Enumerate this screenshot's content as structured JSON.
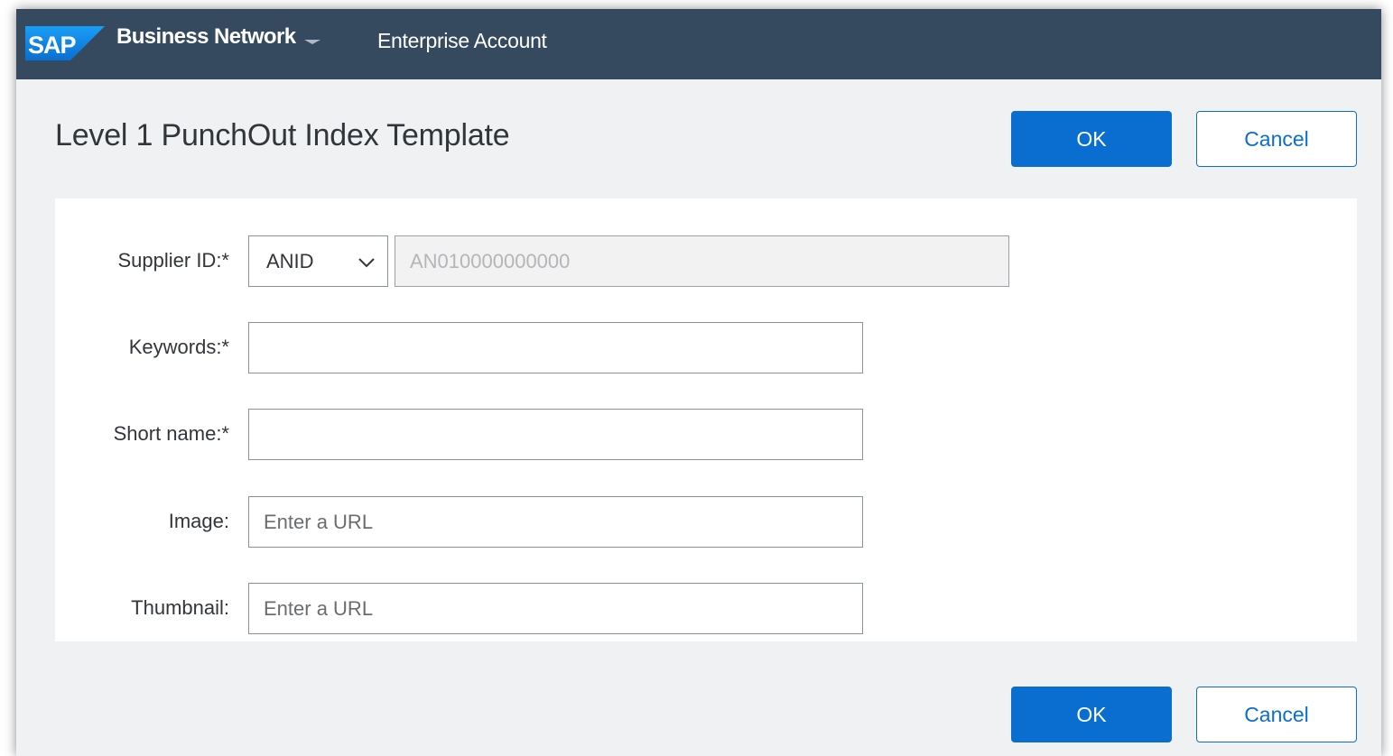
{
  "shellbar": {
    "logo_text": "SAP",
    "product_name": "Business Network",
    "account_type": "Enterprise Account"
  },
  "page": {
    "title": "Level 1 PunchOut Index Template"
  },
  "actions": {
    "ok_label": "OK",
    "cancel_label": "Cancel"
  },
  "form": {
    "supplier_id": {
      "label": "Supplier ID:*",
      "type_value": "ANID",
      "id_value": "AN010000000000"
    },
    "keywords": {
      "label": "Keywords:*",
      "value": "",
      "placeholder": ""
    },
    "short_name": {
      "label": "Short name:*",
      "value": "",
      "placeholder": ""
    },
    "image": {
      "label": "Image:",
      "value": "",
      "placeholder": "Enter a URL"
    },
    "thumbnail": {
      "label": "Thumbnail:",
      "value": "",
      "placeholder": "Enter a URL"
    }
  },
  "colors": {
    "shellbar_bg": "#354a5f",
    "accent": "#0a6ed1",
    "page_bg": "#eff1f2"
  },
  "icons": {
    "logo": "sap-logo",
    "product_menu": "caret-down-icon",
    "select": "chevron-down-icon"
  }
}
